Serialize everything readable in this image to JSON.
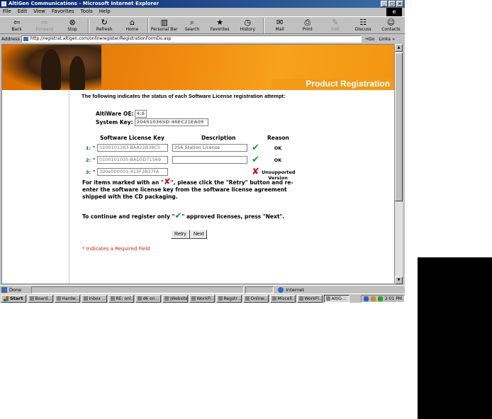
{
  "window": {
    "title": "AltiGen Communications - Microsoft Internet Explorer",
    "controls": [
      "_",
      "□",
      "×"
    ]
  },
  "menu": [
    "File",
    "Edit",
    "View",
    "Favorites",
    "Tools",
    "Help"
  ],
  "toolbar": [
    {
      "label": "Back",
      "icon": "back-arrow-icon",
      "glyph": "⇦",
      "enabled": true
    },
    {
      "label": "Forward",
      "icon": "forward-arrow-icon",
      "glyph": "⇨",
      "enabled": false
    },
    {
      "label": "Stop",
      "icon": "stop-icon",
      "glyph": "⊗",
      "enabled": true
    },
    {
      "label": "Refresh",
      "icon": "refresh-icon",
      "glyph": "↻",
      "enabled": true
    },
    {
      "label": "Home",
      "icon": "home-icon",
      "glyph": "⌂",
      "enabled": true
    },
    {
      "label": "Personal Bar",
      "icon": "personal-bar-icon",
      "glyph": "▥",
      "enabled": true
    },
    {
      "label": "Search",
      "icon": "search-icon",
      "glyph": "⌕",
      "enabled": true
    },
    {
      "label": "Favorites",
      "icon": "favorites-icon",
      "glyph": "★",
      "enabled": true
    },
    {
      "label": "History",
      "icon": "history-icon",
      "glyph": "◷",
      "enabled": true
    },
    {
      "label": "Mail",
      "icon": "mail-icon",
      "glyph": "✉",
      "enabled": true
    },
    {
      "label": "Print",
      "icon": "print-icon",
      "glyph": "⎙",
      "enabled": true
    },
    {
      "label": "Edit",
      "icon": "edit-icon",
      "glyph": "✎",
      "enabled": false
    },
    {
      "label": "Discuss",
      "icon": "discuss-icon",
      "glyph": "☷",
      "enabled": true
    },
    {
      "label": "Contacts",
      "icon": "contacts-icon",
      "glyph": "☺",
      "enabled": true
    }
  ],
  "address": {
    "label": "Address",
    "url": "http://registrat.altigen.com/onlineregister/RegistrationFormDo.asp",
    "go": "→Go",
    "links": "Links »"
  },
  "banner": {
    "title": "Product Registration"
  },
  "page": {
    "intro": "The following indicates the status of each Software License registration attempt:",
    "altiware_os_label": "AltiWare OE:",
    "altiware_os_value": "4.6",
    "system_key_label": "System Key:",
    "system_key_value": "20451036SD-46EC21EA09",
    "headers": {
      "key": "Software License Key",
      "description": "Description",
      "reason": "Reason"
    },
    "required_mark": "*",
    "licenses": [
      {
        "num": "1:",
        "key": "1100101283-BA822B38C5",
        "description": "256 Station License",
        "status": "ok",
        "reason": "OK"
      },
      {
        "num": "2:",
        "key": "0100101035-BAD5D71569",
        "description": "",
        "status": "ok",
        "reason": "OK"
      },
      {
        "num": "3:",
        "key": "300e000001-413F2B37FA",
        "description": null,
        "status": "error",
        "reason": "Unsupported Version"
      }
    ],
    "retry_para_before": "For items marked with an \"",
    "retry_para_after": "\", please click the \"Retry\" button and re-enter the software license key from the software license agreement shipped with the CD packaging.",
    "continue_before": "To continue and register only \"",
    "continue_after": "\" approved licenses, press \"Next\".",
    "retry_button": "Retry",
    "next_button": "Next",
    "required_note": "* Indicates a Required Field"
  },
  "status": {
    "text": "Done",
    "zone": "Internet"
  },
  "taskbar": {
    "start": "Start",
    "items": [
      "Board…",
      "Hardw…",
      "Inbox …",
      "RE: onl…",
      "d6 on…",
      "\\Website",
      "WorkFi…",
      "Regstr…",
      "Online…",
      "Miscell…",
      "WorkFl…",
      "AltiG…"
    ],
    "active_index": 11,
    "clock": "2:01 PM"
  },
  "colors": {
    "banner_orange": "#f08a10",
    "check_green": "#1a9a2a",
    "error_red": "#d01010",
    "required_red": "#d02020"
  }
}
